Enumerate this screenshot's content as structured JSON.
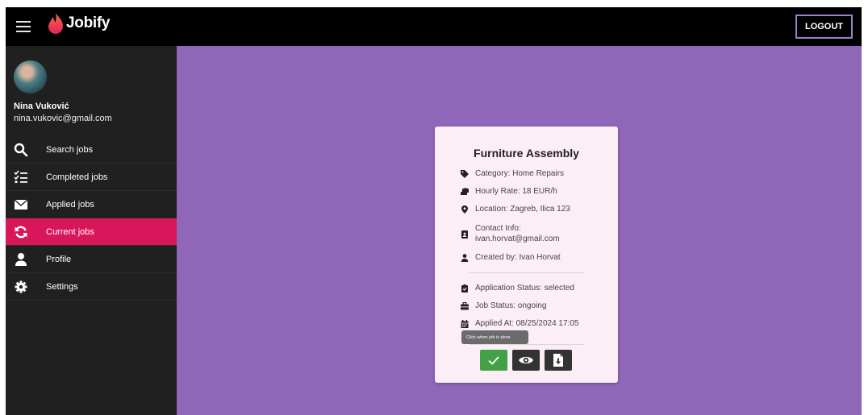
{
  "app": {
    "name": "Jobify",
    "logout_label": "LOGOUT"
  },
  "user": {
    "name": "Nina Vuković",
    "email": "nina.vukovic@gmail.com"
  },
  "sidebar": {
    "items": [
      {
        "label": "Search jobs",
        "icon": "search-icon"
      },
      {
        "label": "Completed jobs",
        "icon": "checklist-icon"
      },
      {
        "label": "Applied jobs",
        "icon": "envelope-icon"
      },
      {
        "label": "Current jobs",
        "icon": "refresh-icon",
        "active": true
      },
      {
        "label": "Profile",
        "icon": "user-icon"
      },
      {
        "label": "Settings",
        "icon": "gear-icon"
      }
    ]
  },
  "job": {
    "title": "Furniture Assembly",
    "category": "Category: Home Repairs",
    "rate": "Hourly Rate: 18 EUR/h",
    "location": "Location: Zagreb, Ilica 123",
    "contact_label": "Contact Info:",
    "contact_email": "ivan.horvat@gmail.com",
    "created_by": "Created by: Ivan Horvat",
    "application_status": "Application Status: selected",
    "job_status": "Job Status: ongoing",
    "applied_at": "Applied At: 08/25/2024 17:05"
  },
  "tooltip": "Click when job is done",
  "colors": {
    "topbar": "#000000",
    "sidebar": "#202020",
    "active": "#d9165a",
    "main_bg": "#8f66b8",
    "card_bg": "#fbeef6",
    "done_button": "#43a047",
    "logout_border": "#9c80c8"
  }
}
